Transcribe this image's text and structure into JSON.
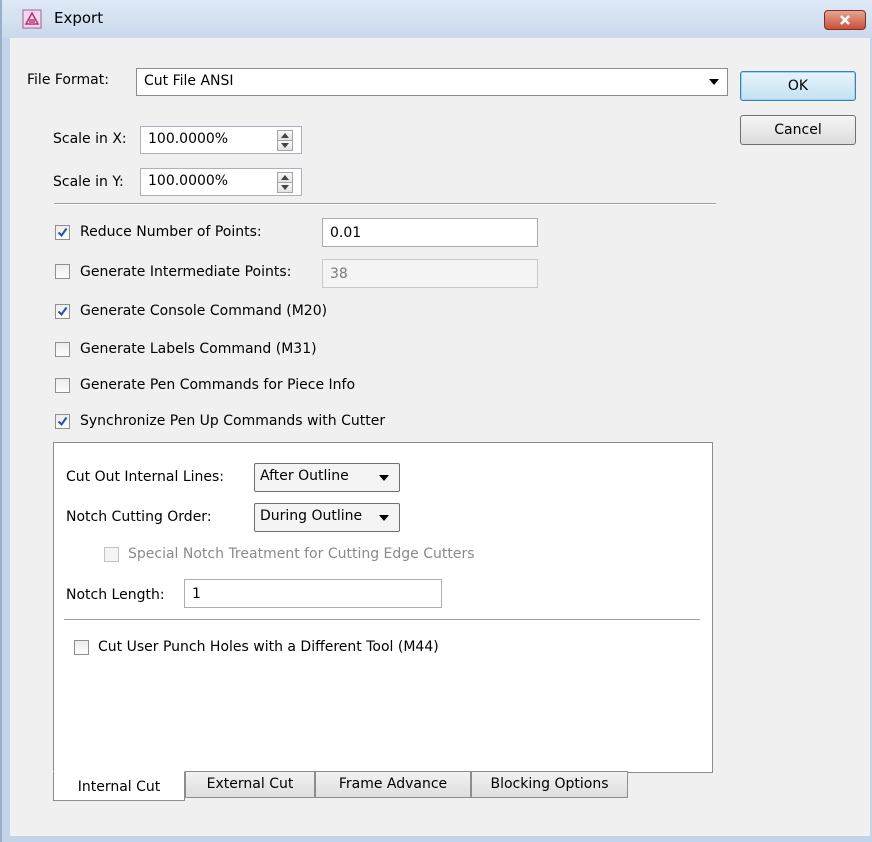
{
  "window": {
    "title": "Export"
  },
  "file_format": {
    "label": "File Format:",
    "value": "Cut File ANSI"
  },
  "buttons": {
    "ok": "OK",
    "cancel": "Cancel"
  },
  "scale_x": {
    "label": "Scale in X:",
    "value": "100.0000%"
  },
  "scale_y": {
    "label": "Scale in Y:",
    "value": "100.0000%"
  },
  "options": {
    "reduce_points": {
      "label": "Reduce Number of Points:",
      "checked": true,
      "value": "0.01"
    },
    "intermediate_points": {
      "label": "Generate Intermediate Points:",
      "checked": false,
      "value": "38"
    },
    "console_command": {
      "label": "Generate Console Command (M20)",
      "checked": true
    },
    "labels_command": {
      "label": "Generate Labels Command (M31)",
      "checked": false
    },
    "pen_commands": {
      "label": "Generate Pen Commands for Piece Info",
      "checked": false
    },
    "sync_pen_up": {
      "label": "Synchronize Pen Up Commands with Cutter",
      "checked": true
    }
  },
  "internal_cut": {
    "cut_out_internal_lines": {
      "label": "Cut Out Internal Lines:",
      "value": "After Outline"
    },
    "notch_cutting_order": {
      "label": "Notch Cutting Order:",
      "value": "During Outline"
    },
    "special_notch": {
      "label": "Special Notch Treatment for Cutting Edge Cutters",
      "checked": false
    },
    "notch_length": {
      "label": "Notch Length:",
      "value": "1"
    },
    "punch_holes": {
      "label": "Cut User Punch Holes with a Different Tool (M44)",
      "checked": false
    }
  },
  "tabs": [
    "Internal Cut",
    "External Cut",
    "Frame Advance",
    "Blocking Options"
  ],
  "active_tab": "Internal Cut",
  "colors": {
    "titlebar": "#c9d9ec",
    "close": "#c9503a",
    "dialog_bg": "#f0f0f0",
    "default_button": "#c4e1f3"
  }
}
